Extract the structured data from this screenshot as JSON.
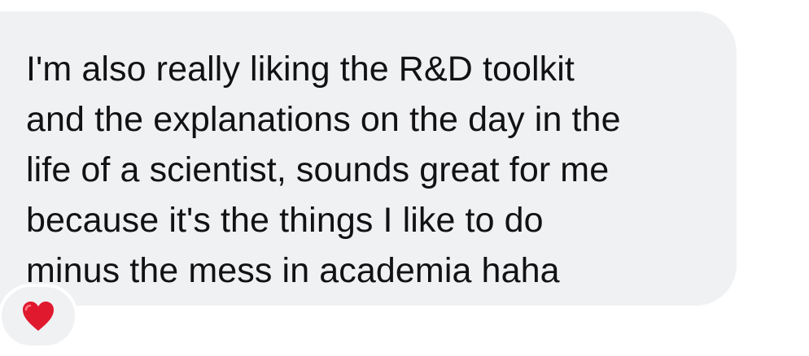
{
  "message": {
    "text": "I'm also really liking the R&D toolkit\nand the explanations on the day in the\nlife of a scientist, sounds great for me\nbecause it's the things I like to do\nminus the mess in academia haha"
  },
  "reaction": {
    "icon": "heart-icon",
    "color": "#e0192f"
  },
  "colors": {
    "bubble": "#f0f1f3",
    "text": "#121214",
    "background": "#ffffff"
  }
}
